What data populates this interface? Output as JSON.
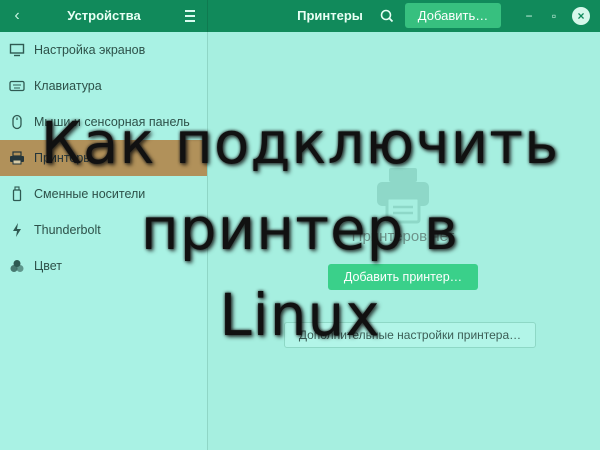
{
  "header": {
    "left_title": "Устройства",
    "right_title": "Принтеры",
    "add_button": "Добавить…",
    "icons": [
      "chevron-left-icon",
      "hamburger-menu-icon",
      "search-icon",
      "minimize-icon",
      "maximize-icon",
      "close-icon"
    ],
    "accent": "#118a5b"
  },
  "sidebar": {
    "items": [
      {
        "label": "Настройка экранов",
        "icon": "display-icon"
      },
      {
        "label": "Клавиатура",
        "icon": "keyboard-icon"
      },
      {
        "label": "Мыши и сенсорная панель",
        "icon": "mouse-icon"
      },
      {
        "label": "Принтеры",
        "icon": "printer-icon",
        "active": true
      },
      {
        "label": "Сменные носители",
        "icon": "usb-drive-icon"
      },
      {
        "label": "Thunderbolt",
        "icon": "thunderbolt-icon"
      },
      {
        "label": "Цвет",
        "icon": "color-icon"
      }
    ]
  },
  "main": {
    "empty_label": "Принтеров нет",
    "add_printer_button": "Добавить принтер…",
    "advanced_button": "Дополнительные настройки принтера…"
  },
  "overlay": {
    "lines": [
      "Как подключить",
      "принтер в",
      "Linux"
    ]
  }
}
